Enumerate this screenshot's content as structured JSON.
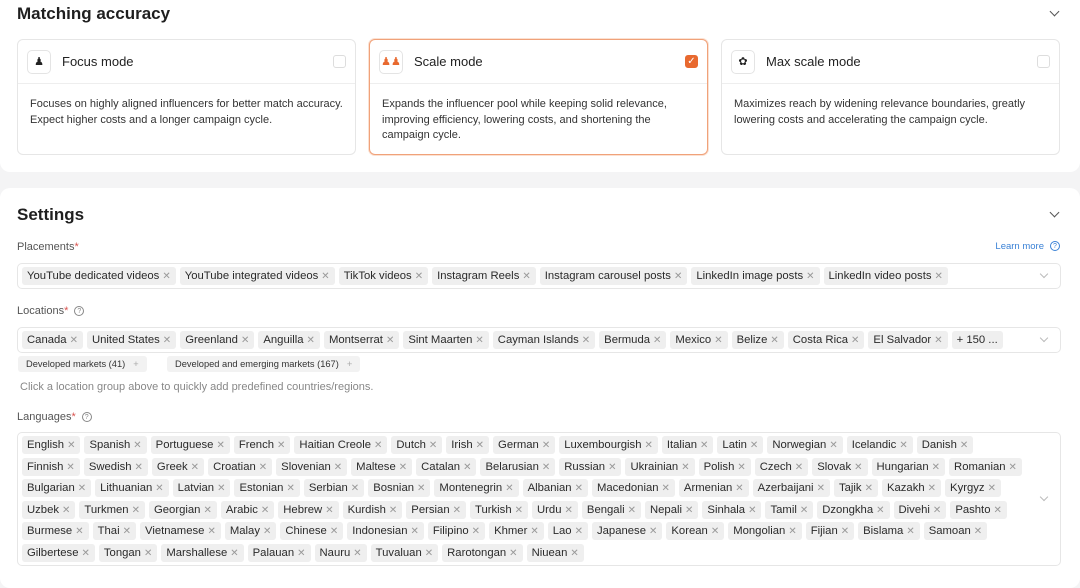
{
  "accuracy": {
    "title": "Matching accuracy",
    "modes": [
      {
        "name": "Focus mode",
        "icon": "person-icon",
        "checked": false,
        "desc": "Focuses on highly aligned influencers for better match accuracy. Expect higher costs and a longer campaign cycle."
      },
      {
        "name": "Scale mode",
        "icon": "people-icon",
        "checked": true,
        "desc": "Expands the influencer pool while keeping solid relevance, improving efficiency, lowering costs, and shortening the campaign cycle."
      },
      {
        "name": "Max scale mode",
        "icon": "paw-icon",
        "checked": false,
        "desc": "Maximizes reach by widening relevance boundaries, greatly lowering costs and accelerating the campaign cycle."
      }
    ]
  },
  "settings": {
    "title": "Settings",
    "placements": {
      "label": "Placements",
      "req": "*",
      "learn_more": "Learn more",
      "tags": [
        "YouTube dedicated videos",
        "YouTube integrated videos",
        "TikTok videos",
        "Instagram Reels",
        "Instagram carousel posts",
        "LinkedIn image posts",
        "LinkedIn video posts"
      ]
    },
    "locations": {
      "label": "Locations",
      "req": "*",
      "tags": [
        "Canada",
        "United States",
        "Greenland",
        "Anguilla",
        "Montserrat",
        "Sint Maarten",
        "Cayman Islands",
        "Bermuda",
        "Mexico",
        "Belize",
        "Costa Rica",
        "El Salvador"
      ],
      "more": "+ 150 ...",
      "groups": [
        "Developed markets (41)",
        "Developed and emerging markets (167)"
      ],
      "hint": "Click a location group above to quickly add predefined countries/regions."
    },
    "languages": {
      "label": "Languages",
      "req": "*",
      "tags": [
        "English",
        "Spanish",
        "Portuguese",
        "French",
        "Haitian Creole",
        "Dutch",
        "Irish",
        "German",
        "Luxembourgish",
        "Italian",
        "Latin",
        "Norwegian",
        "Icelandic",
        "Danish",
        "Finnish",
        "Swedish",
        "Greek",
        "Croatian",
        "Slovenian",
        "Maltese",
        "Catalan",
        "Belarusian",
        "Russian",
        "Ukrainian",
        "Polish",
        "Czech",
        "Slovak",
        "Hungarian",
        "Romanian",
        "Bulgarian",
        "Lithuanian",
        "Latvian",
        "Estonian",
        "Serbian",
        "Bosnian",
        "Montenegrin",
        "Albanian",
        "Macedonian",
        "Armenian",
        "Azerbaijani",
        "Tajik",
        "Kazakh",
        "Kyrgyz",
        "Uzbek",
        "Turkmen",
        "Georgian",
        "Arabic",
        "Hebrew",
        "Kurdish",
        "Persian",
        "Turkish",
        "Urdu",
        "Bengali",
        "Nepali",
        "Sinhala",
        "Tamil",
        "Dzongkha",
        "Divehi",
        "Pashto",
        "Burmese",
        "Thai",
        "Vietnamese",
        "Malay",
        "Chinese",
        "Indonesian",
        "Filipino",
        "Khmer",
        "Lao",
        "Japanese",
        "Korean",
        "Mongolian",
        "Fijian",
        "Bislama",
        "Samoan",
        "Gilbertese",
        "Tongan",
        "Marshallese",
        "Palauan",
        "Nauru",
        "Tuvaluan",
        "Rarotongan",
        "Niuean"
      ]
    }
  },
  "colors": {
    "accent": "#e8692f",
    "link": "#3b82d6"
  }
}
